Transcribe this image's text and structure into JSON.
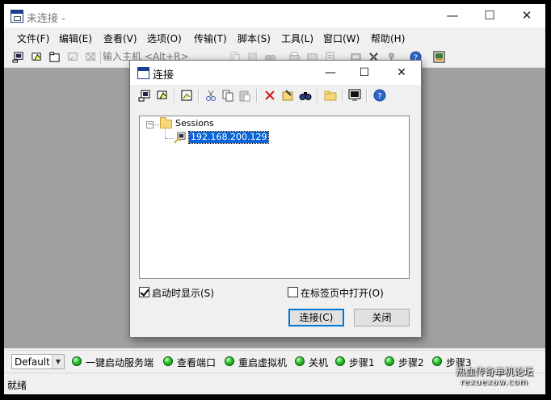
{
  "window": {
    "title": "未连接 -",
    "minimize": "—",
    "maximize": "☐",
    "close": "✕"
  },
  "menu": [
    "文件(F)",
    "编辑(E)",
    "查看(V)",
    "选项(O)",
    "传输(T)",
    "脚本(S)",
    "工具(L)",
    "窗口(W)",
    "帮助(H)"
  ],
  "toolbar": {
    "quick_connect_placeholder": "输入主机 <Alt+R>"
  },
  "dialog": {
    "title": "连接",
    "minimize": "—",
    "maximize": "☐",
    "close": "✕",
    "tree": {
      "root": "Sessions",
      "items": [
        "192.168.200.129"
      ]
    },
    "show_on_startup": {
      "label": "启动时显示(S)",
      "checked": true
    },
    "open_in_tab": {
      "label": "在标签页中打开(O)",
      "checked": false
    },
    "connect_button": "连接(C)",
    "close_button": "关闭"
  },
  "button_bar": {
    "session_select": "Default",
    "commands": [
      "一键启动服务端",
      "查看端口",
      "重启虚拟机",
      "关机",
      "步骤1",
      "步骤2",
      "步骤3"
    ]
  },
  "status": "就绪",
  "watermark": {
    "line1": "热血传奇单机论坛",
    "line2": "rexuexaw.com"
  },
  "colors": {
    "accent": "#0078d7",
    "selection": "#0a64d8",
    "workspace": "#a0a0a0",
    "led": "#33c733"
  }
}
